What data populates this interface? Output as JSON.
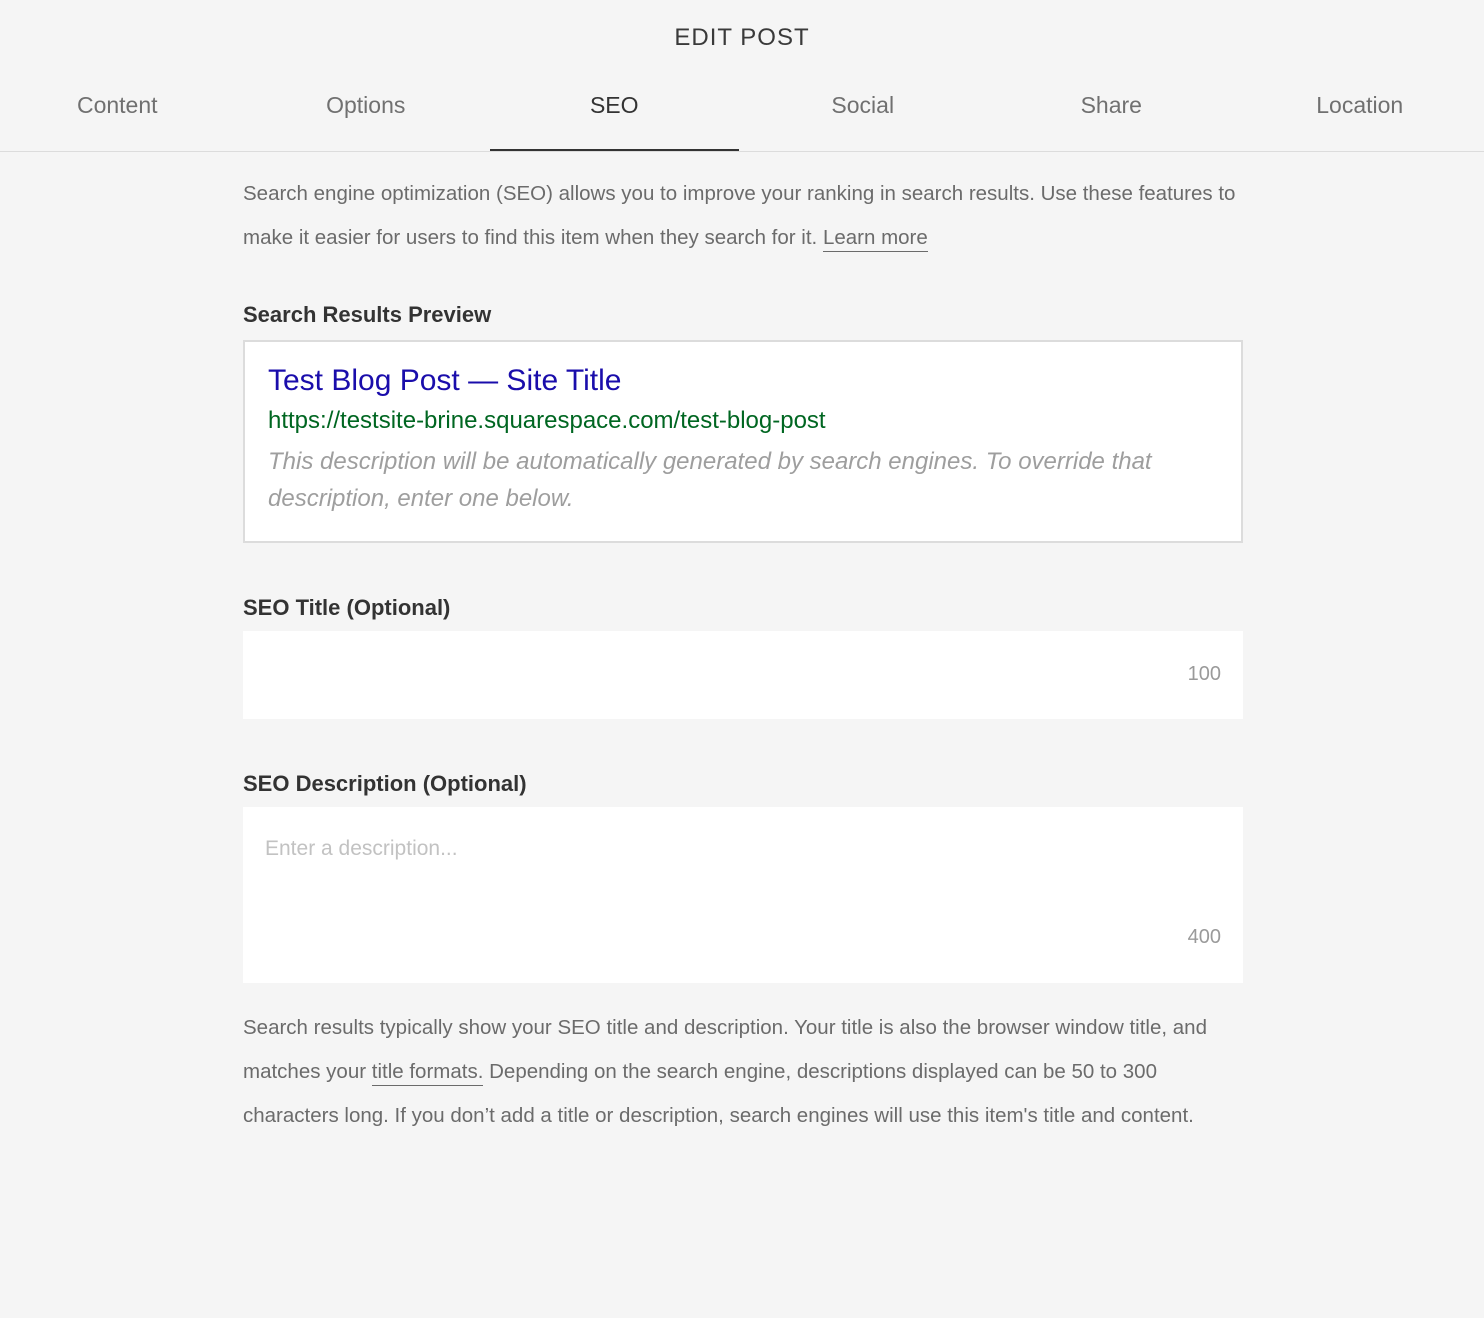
{
  "header": {
    "title": "EDIT POST",
    "tabs": [
      {
        "label": "Content"
      },
      {
        "label": "Options"
      },
      {
        "label": "SEO"
      },
      {
        "label": "Social"
      },
      {
        "label": "Share"
      },
      {
        "label": "Location"
      }
    ],
    "active_tab": "SEO"
  },
  "intro": {
    "text": "Search engine optimization (SEO) allows you to improve your ranking in search results. Use these features to make it easier for users to find this item when they search for it.",
    "link": "Learn more"
  },
  "preview": {
    "label": "Search Results Preview",
    "title": "Test Blog Post — Site Title",
    "url": "https://testsite-brine.squarespace.com/test-blog-post",
    "description": "This description will be automatically generated by search engines. To override that description, enter one below."
  },
  "seo_title": {
    "label": "SEO Title (Optional)",
    "value": "",
    "counter": "100"
  },
  "seo_description": {
    "label": "SEO Description (Optional)",
    "placeholder": "Enter a description...",
    "value": "",
    "counter": "400"
  },
  "footer": {
    "text_before": "Search results typically show your SEO title and description. Your title is also the browser window title, and matches your",
    "link": "title formats.",
    "text_after": "Depending on the search engine, descriptions displayed can be 50 to 300 characters long. If you don’t add a title or description, search engines will use this item's title and content."
  },
  "colors": {
    "background": "#f5f5f5",
    "preview_title": "#1a0dab",
    "preview_url": "#006621"
  }
}
